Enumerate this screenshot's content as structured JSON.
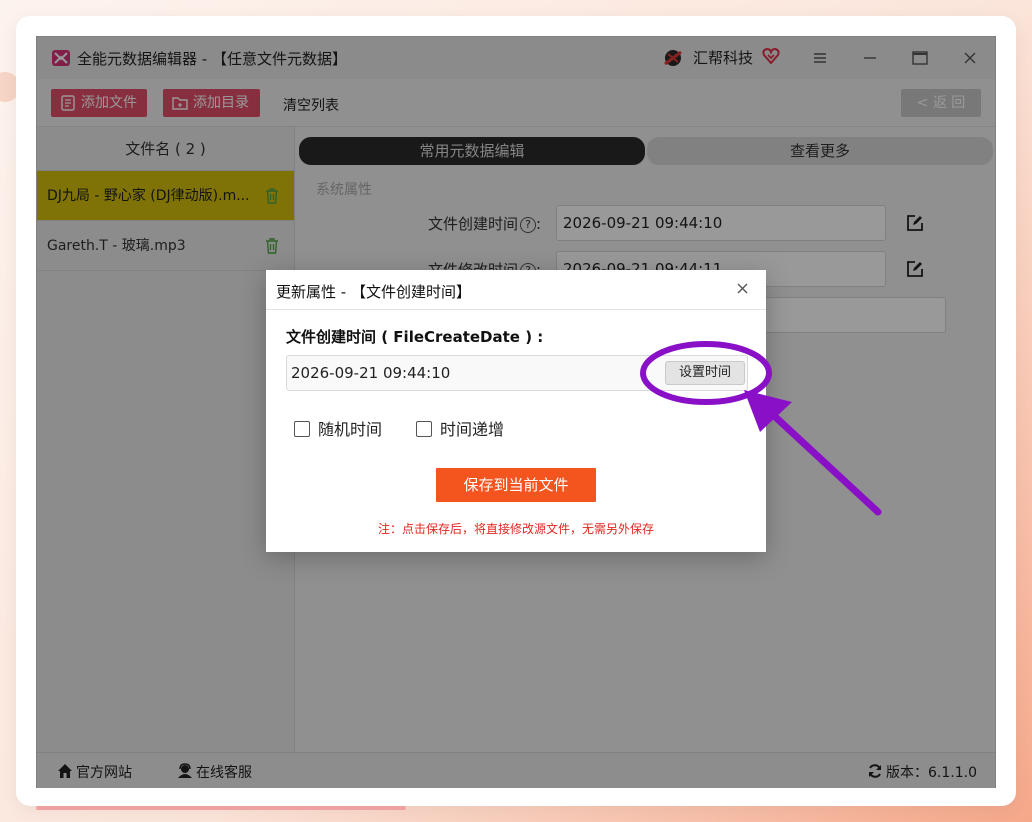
{
  "window": {
    "title": "全能元数据编辑器 - 【任意文件元数据】",
    "brand": "汇帮科技"
  },
  "toolbar": {
    "add_file": "添加文件",
    "add_dir": "添加目录",
    "clear_list": "清空列表",
    "back": "< 返 回"
  },
  "file_list": {
    "header": "文件名 ( 2 )",
    "items": [
      {
        "name": "DJ九局 - 野心家 (DJ律动版).m..."
      },
      {
        "name": "Gareth.T - 玻璃.mp3"
      }
    ]
  },
  "tabs": {
    "common": "常用元数据编辑",
    "more": "查看更多"
  },
  "properties": {
    "section": "系统属性",
    "create_label": "文件创建时间",
    "create_value": "2026-09-21 09:44:10",
    "modify_label": "文件修改时间",
    "modify_value": "2026-09-21 09:44:11",
    "colon": ":",
    "help": "?"
  },
  "statusbar": {
    "website": "官方网站",
    "support": "在线客服",
    "version": "版本：6.1.1.0"
  },
  "dialog": {
    "title": "更新属性 - 【文件创建时间】",
    "field_label": "文件创建时间 ( FileCreateDate ) :",
    "value": "2026-09-21 09:44:10",
    "set_time": "设置时间",
    "random_time": "随机时间",
    "time_increment": "时间递增",
    "save": "保存到当前文件",
    "note": "注：点击保存后，将直接修改源文件，无需另外保存"
  },
  "colors": {
    "accent": "#e24f6a",
    "selected_row": "#d4c00c",
    "save_button": "#f4541e",
    "annotation": "#8a10c8",
    "note": "#e3261f"
  }
}
